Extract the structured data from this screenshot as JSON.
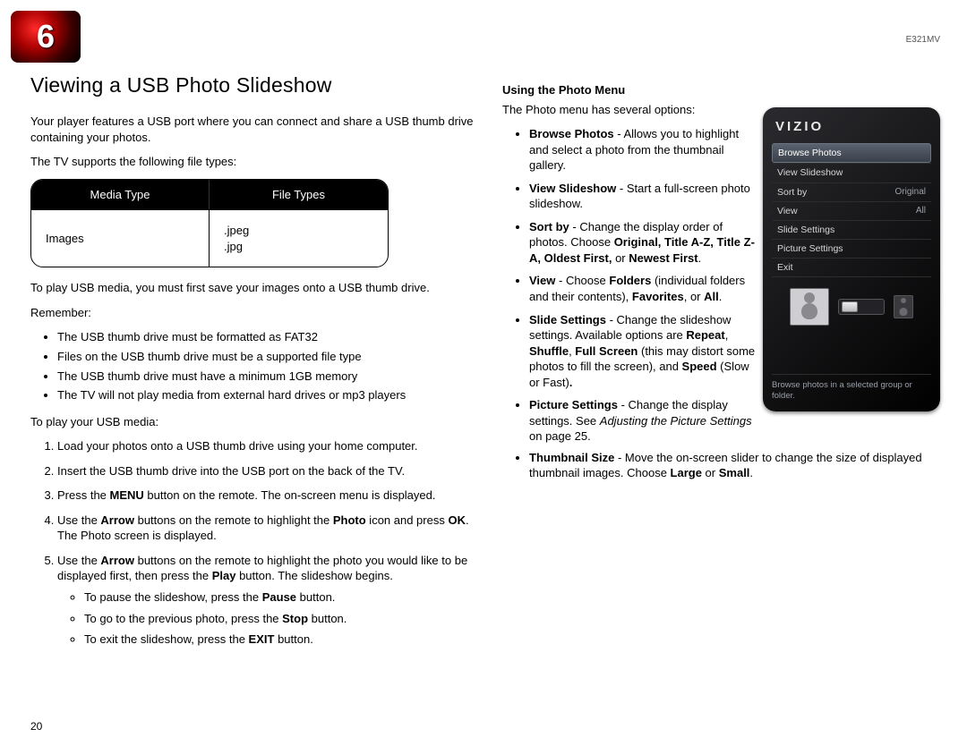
{
  "chapter_number": "6",
  "model": "E321MV",
  "page_number": "20",
  "section_title": "Viewing a USB Photo Slideshow",
  "left": {
    "intro": "Your player features a USB port where you can connect and share a USB thumb drive containing your photos.",
    "supports": "The TV supports the following file types:",
    "table": {
      "h1": "Media Type",
      "h2": "File Types",
      "r1c1": "Images",
      "r1c2a": ".jpeg",
      "r1c2b": ".jpg"
    },
    "save_note": "To play USB media, you must first save your images onto a USB thumb drive.",
    "remember_label": "Remember:",
    "remember": [
      "The USB thumb drive must be formatted as FAT32",
      "Files on the USB thumb drive must be a supported file type",
      "The USB thumb drive must have a minimum 1GB memory",
      "The TV will not play media from external hard drives or mp3 players"
    ],
    "play_label": "To play your USB media:",
    "steps": {
      "s1": "Load your photos onto a USB thumb drive using your home computer.",
      "s2": "Insert the USB thumb drive into the USB port on the back of the TV.",
      "s3a": "Press the ",
      "s3b": "MENU",
      "s3c": " button on the remote. The on-screen menu is displayed.",
      "s4a": "Use the ",
      "s4b": "Arrow",
      "s4c": " buttons on the remote to highlight the ",
      "s4d": "Photo",
      "s4e": " icon and press ",
      "s4f": "OK",
      "s4g": ". The Photo screen is displayed.",
      "s5a": "Use the ",
      "s5b": "Arrow",
      "s5c": " buttons on the remote to highlight the photo you would like to be displayed first, then press the ",
      "s5d": "Play",
      "s5e": " button. The slideshow begins.",
      "s5sub": {
        "a1": "To pause the slideshow, press the ",
        "a2": "Pause",
        "a3": " button.",
        "b1": "To go to the previous photo, press the ",
        "b2": "Stop",
        "b3": " button.",
        "c1": "To exit the slideshow, press the ",
        "c2": "EXIT",
        "c3": " button."
      }
    }
  },
  "right": {
    "subhead": "Using the Photo Menu",
    "intro": "The Photo menu has several options:",
    "items": {
      "browse_t": "Browse Photos",
      "browse_d": " - Allows you to highlight and select a photo from the thumbnail gallery.",
      "view_t": "View Slideshow",
      "view_d": " - Start a full-screen photo slideshow.",
      "sort_t": "Sort by",
      "sort_d1": " - Change the display order of photos. Choose ",
      "sort_d2": "Original, Title A-Z, Title Z-A, Oldest First,",
      "sort_d3": " or ",
      "sort_d4": "Newest First",
      "viewopt_t": "View",
      "viewopt_d1": " - Choose ",
      "viewopt_d2": "Folders",
      "viewopt_d3": " (individual folders and their contents), ",
      "viewopt_d4": "Favorites",
      "viewopt_d5": ", or ",
      "viewopt_d6": "All",
      "slide_t": "Slide Settings",
      "slide_d1": " - Change the slideshow settings. Available options are ",
      "slide_d2": "Repeat",
      "slide_d3": ", ",
      "slide_d4": "Shuffle",
      "slide_d5": ", ",
      "slide_d6": "Full Screen",
      "slide_d7": " (this may distort some photos to fill the screen), and ",
      "slide_d8": "Speed",
      "slide_d9": " (Slow or Fast)",
      "pic_t": "Picture Settings",
      "pic_d1": " - Change the display settings. See ",
      "pic_d2": "Adjusting the Picture Settings",
      "pic_d3": " on page 25.",
      "thumb_t": "Thumbnail Size",
      "thumb_d1": " - Move the on-screen slider to change the size of displayed thumbnail images. Choose ",
      "thumb_d2": "Large",
      "thumb_d3": " or ",
      "thumb_d4": "Small"
    }
  },
  "device": {
    "brand": "VIZIO",
    "menu": [
      {
        "label": "Browse Photos",
        "val": "",
        "sel": true
      },
      {
        "label": "View Slideshow",
        "val": ""
      },
      {
        "label": "Sort by",
        "val": "Original"
      },
      {
        "label": "View",
        "val": "All"
      },
      {
        "label": "Slide Settings",
        "val": ""
      },
      {
        "label": "Picture Settings",
        "val": ""
      },
      {
        "label": "Exit",
        "val": ""
      }
    ],
    "hint": "Browse photos in a selected group or folder."
  }
}
